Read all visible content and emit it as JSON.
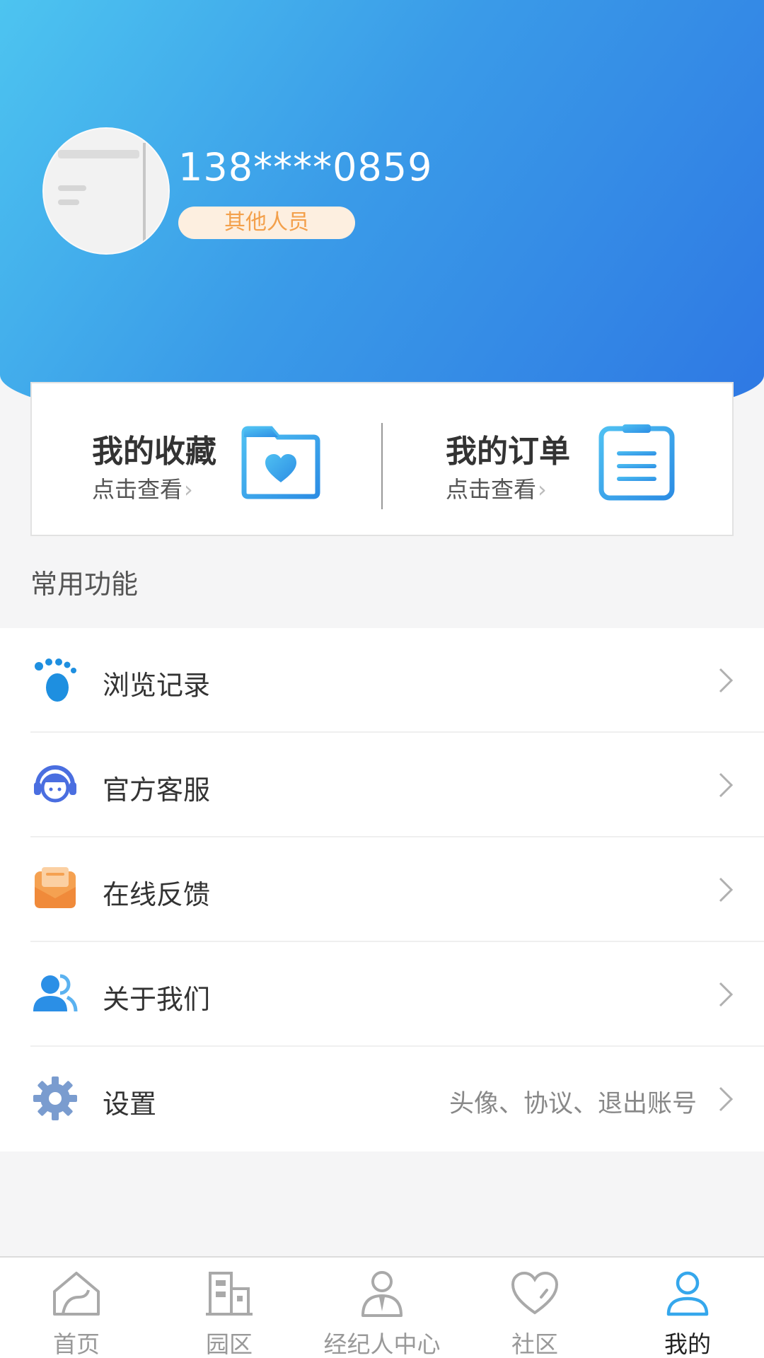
{
  "profile": {
    "phone": "138****0859",
    "role": "其他人员"
  },
  "quick": {
    "favorites": {
      "title": "我的收藏",
      "subtitle": "点击查看",
      "arrow": "›",
      "icon": "folder-heart-icon"
    },
    "orders": {
      "title": "我的订单",
      "subtitle": "点击查看",
      "arrow": "›",
      "icon": "clipboard-icon"
    }
  },
  "section": {
    "title": "常用功能"
  },
  "menu": [
    {
      "label": "浏览记录",
      "hint": "",
      "icon": "footprint-icon"
    },
    {
      "label": "官方客服",
      "hint": "",
      "icon": "headset-icon"
    },
    {
      "label": "在线反馈",
      "hint": "",
      "icon": "feedback-mail-icon"
    },
    {
      "label": "关于我们",
      "hint": "",
      "icon": "users-icon"
    },
    {
      "label": "设置",
      "hint": "头像、协议、退出账号",
      "icon": "gear-icon"
    }
  ],
  "tabs": [
    {
      "label": "首页",
      "icon": "home-icon",
      "active": false
    },
    {
      "label": "园区",
      "icon": "building-icon",
      "active": false
    },
    {
      "label": "经纪人中心",
      "icon": "agent-icon",
      "active": false
    },
    {
      "label": "社区",
      "icon": "heart-icon",
      "active": false
    },
    {
      "label": "我的",
      "icon": "user-icon",
      "active": true
    }
  ],
  "colors": {
    "header_start": "#4dc4f0",
    "header_end": "#2e77e3",
    "badge_bg": "#fdefe0",
    "badge_text": "#f3a04b",
    "accent_blue": "#3b9de9",
    "active_tab": "#35a7ec"
  }
}
